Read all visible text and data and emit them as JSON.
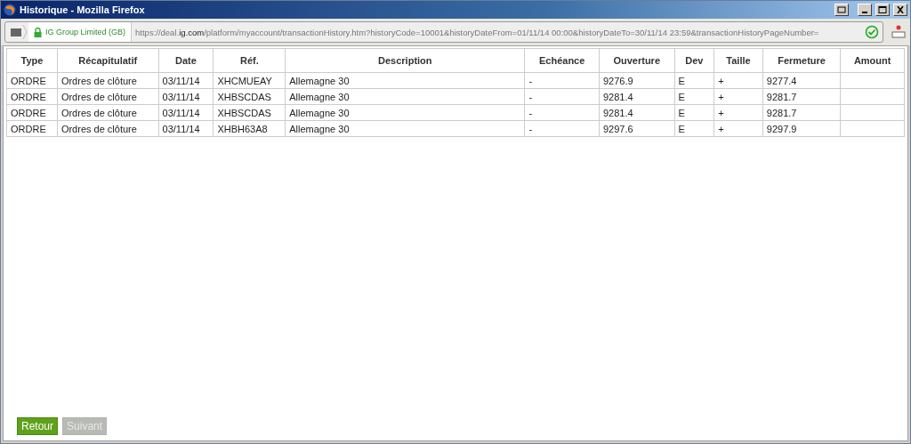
{
  "window": {
    "title": "Historique - Mozilla Firefox"
  },
  "address_bar": {
    "identity": "IG Group Limited (GB)",
    "url_prefix": "https://deal.",
    "url_domain": "ig.com",
    "url_rest": "/platform/myaccount/transactionHistory.htm?historyCode=10001&historyDateFrom=01/11/14 00:00&historyDateTo=30/11/14 23:59&transactionHistoryPageNumber="
  },
  "table": {
    "columns": [
      "Type",
      "Récapitulatif",
      "Date",
      "Réf.",
      "Description",
      "Echéance",
      "Ouverture",
      "Dev",
      "Taille",
      "Fermeture",
      "Amount"
    ],
    "rows": [
      [
        "ORDRE",
        "Ordres de clôture",
        "03/11/14",
        "XHCMUEAY",
        "Allemagne 30",
        "-",
        "9276.9",
        "E",
        "+",
        "9277.4",
        ""
      ],
      [
        "ORDRE",
        "Ordres de clôture",
        "03/11/14",
        "XHBSCDAS",
        "Allemagne 30",
        "-",
        "9281.4",
        "E",
        "+",
        "9281.7",
        ""
      ],
      [
        "ORDRE",
        "Ordres de clôture",
        "03/11/14",
        "XHBSCDAS",
        "Allemagne 30",
        "-",
        "9281.4",
        "E",
        "+",
        "9281.7",
        ""
      ],
      [
        "ORDRE",
        "Ordres de clôture",
        "03/11/14",
        "XHBH63A8",
        "Allemagne 30",
        "-",
        "9297.6",
        "E",
        "+",
        "9297.9",
        ""
      ]
    ]
  },
  "buttons": [
    {
      "label": "Retour",
      "disabled": false
    },
    {
      "label": "Suivant",
      "disabled": true
    }
  ]
}
